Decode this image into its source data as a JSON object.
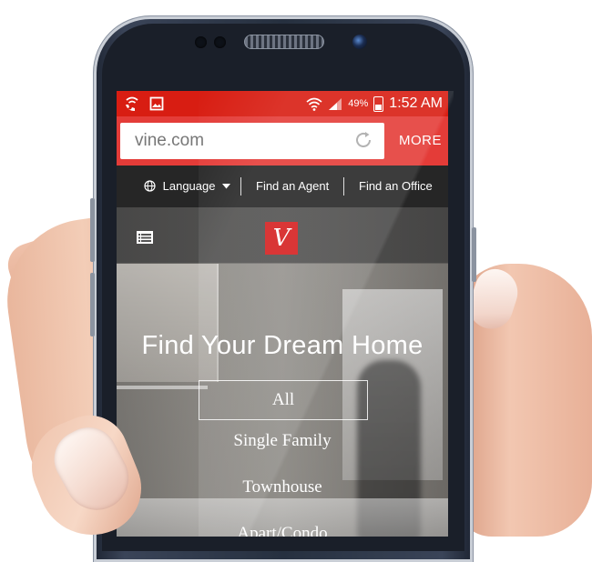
{
  "statusbar": {
    "battery": "49%",
    "time": "1:52 AM",
    "icons": [
      "wifi-call-icon",
      "image-notification-icon",
      "wifi-icon",
      "signal-icon",
      "battery-icon"
    ]
  },
  "browser": {
    "url": "vine.com",
    "more_label": "MORE",
    "reload_icon": "reload-icon"
  },
  "topnav": {
    "language_label": "Language",
    "find_agent": "Find an Agent",
    "find_office": "Find an Office"
  },
  "site": {
    "logo_letter": "V",
    "menu_icon": "list-menu-icon",
    "brand_color": "#d51f1f"
  },
  "hero": {
    "title": "Find Your Dream Home",
    "categories": [
      "All",
      "Single Family",
      "Townhouse",
      "Apart/Condo"
    ]
  },
  "colors": {
    "statusbar": "#d81d12",
    "urlbar": "#e43c38",
    "nav": "#262626"
  }
}
